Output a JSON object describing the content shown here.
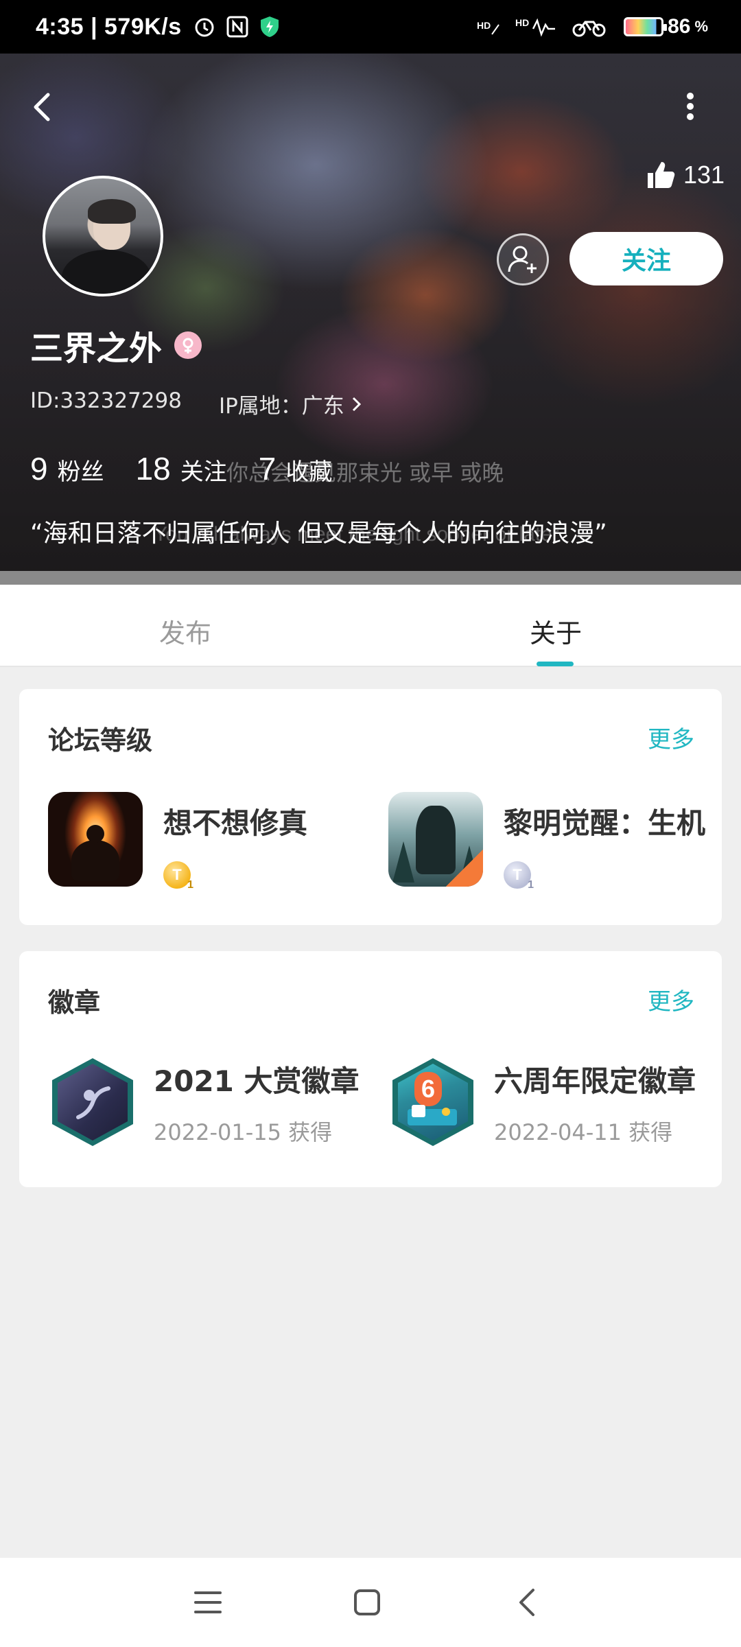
{
  "status_bar": {
    "time": "4:35",
    "net_speed": "| 579K/s",
    "battery_percent": "86",
    "battery_unit": "%",
    "icons": [
      "alarm-icon",
      "nfc-icon",
      "shield-icon",
      "hd-icon",
      "hd-signal-icon",
      "bike-icon",
      "battery-icon"
    ]
  },
  "profile": {
    "likes": "131",
    "follow_label": "关注",
    "username": "三界之外",
    "user_id": "ID:332327298",
    "ip_location": "IP属地：广东",
    "stats": [
      {
        "count": "9",
        "label": "粉丝"
      },
      {
        "count": "18",
        "label": "关注"
      },
      {
        "count": "7",
        "label": "收藏"
      }
    ],
    "bio": "“海和日落不归属任何人  但又是每个人的向往的浪漫”",
    "background_lyric": "你总会遇见那束光  或早  或晚",
    "background_lyric_en": "You will always meet the light sooner or later"
  },
  "tabs": [
    {
      "label": "发布",
      "active": false
    },
    {
      "label": "关于",
      "active": true
    }
  ],
  "forum_card": {
    "title": "论坛等级",
    "more": "更多",
    "items": [
      {
        "name": "想不想修真",
        "level": "T"
      },
      {
        "name": "黎明觉醒：生机",
        "level": "T"
      }
    ]
  },
  "badge_card": {
    "title": "徽章",
    "more": "更多",
    "items": [
      {
        "name": "2021 大赏徽章",
        "date": "2022-01-15 获得"
      },
      {
        "name": "六周年限定徽章",
        "date": "2022-04-11 获得"
      }
    ]
  },
  "colors": {
    "accent": "#21b7c2",
    "follow_text": "#16b0bd",
    "page_bg": "#efefef"
  }
}
